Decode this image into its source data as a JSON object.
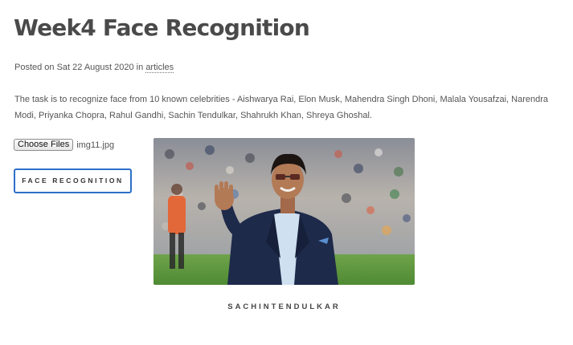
{
  "page": {
    "title": "Week4 Face Recognition"
  },
  "meta": {
    "posted_on": "Posted on Sat 22 August 2020 in",
    "category": "articles"
  },
  "task": {
    "description": "The task is to recognize face from 10 known celebrities - Aishwarya Rai, Elon Musk, Mahendra Singh Dhoni, Malala Yousafzai, Narendra Modi, Priyanka Chopra, Rahul Gandhi, Sachin Tendulkar, Shahrukh Khan, Shreya Ghoshal."
  },
  "upload": {
    "button_label": "Choose Files",
    "file_name": "img11.jpg"
  },
  "action": {
    "recognize_label": "FACE RECOGNITION"
  },
  "result": {
    "label": "SACHINTENDULKAR"
  },
  "colors": {
    "button_border": "#2d6fc8",
    "title": "#4a4a4a"
  }
}
